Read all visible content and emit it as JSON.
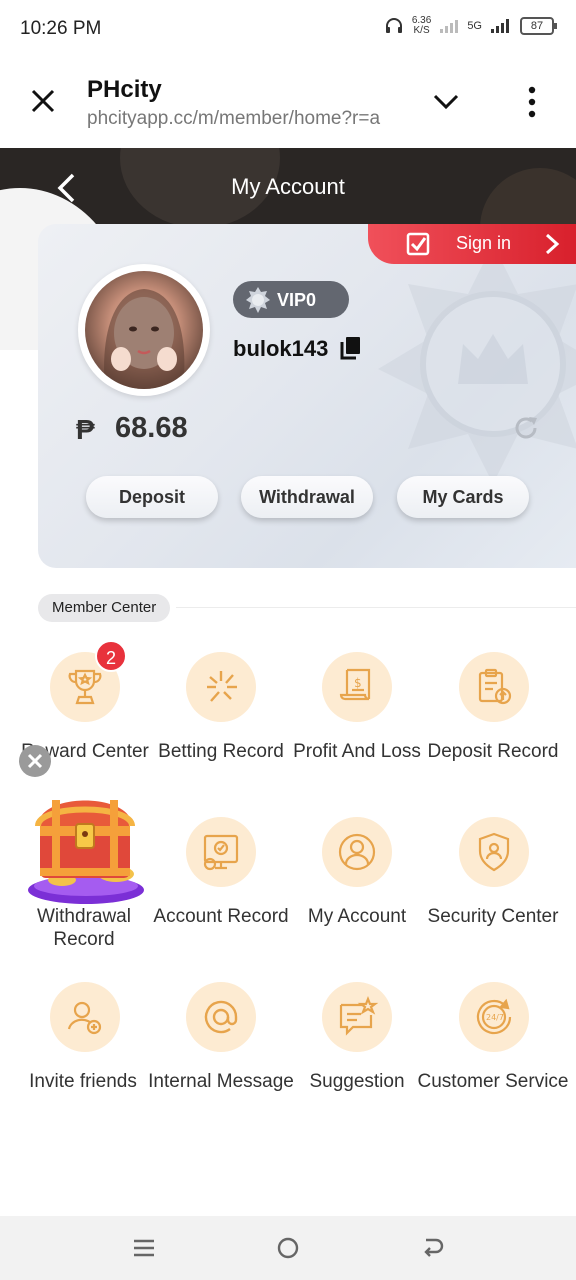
{
  "status": {
    "time": "10:26 PM",
    "speed_value": "6.36",
    "speed_unit": "K/S",
    "network": "5G",
    "battery": "87"
  },
  "browser": {
    "title": "PHcity",
    "url": "phcityapp.cc/m/member/home?r=a"
  },
  "header": {
    "title": "My Account"
  },
  "account": {
    "sign_in_label": "Sign in",
    "vip_label": "VIP0",
    "username": "bulok143",
    "currency_symbol": "₱",
    "balance": "68.68",
    "buttons": {
      "deposit": "Deposit",
      "withdrawal": "Withdrawal",
      "my_cards": "My Cards"
    }
  },
  "member_center": {
    "title": "Member Center",
    "items": [
      {
        "label": "Reward Center",
        "icon": "trophy-icon",
        "badge": "2"
      },
      {
        "label": "Betting Record",
        "icon": "betting-star-icon"
      },
      {
        "label": "Profit And Loss",
        "icon": "receipt-dollar-icon"
      },
      {
        "label": "Deposit Record",
        "icon": "clipboard-upload-icon"
      },
      {
        "label": "Withdrawal Record",
        "icon": "treasure-chest-icon"
      },
      {
        "label": "Account Record",
        "icon": "monitor-chart-icon"
      },
      {
        "label": "My Account",
        "icon": "user-circle-icon"
      },
      {
        "label": "Security Center",
        "icon": "shield-user-icon"
      },
      {
        "label": "Invite friends",
        "icon": "user-plus-icon"
      },
      {
        "label": "Internal Message",
        "icon": "at-sign-icon"
      },
      {
        "label": "Suggestion",
        "icon": "chat-star-icon"
      },
      {
        "label": "Customer Service",
        "icon": "clock-247-icon"
      }
    ]
  },
  "colors": {
    "accent_red": "#e8323c",
    "icon_bg": "#fdebd2",
    "icon_stroke": "#e7a44c",
    "header_dark": "#2a2624"
  }
}
